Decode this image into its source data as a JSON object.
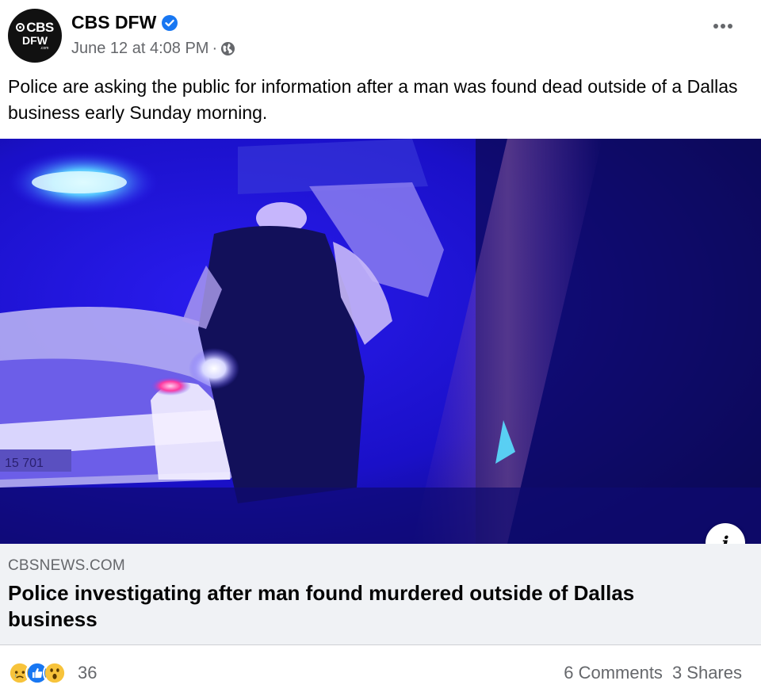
{
  "post": {
    "page_name": "CBS DFW",
    "avatar": {
      "line1": "CBS",
      "line2": "DFW",
      "line3": ".com"
    },
    "timestamp": "June 12 at 4:08 PM",
    "separator": "·",
    "audience_icon": "globe-icon",
    "verified_icon": "verified-badge-icon",
    "menu_icon": "more-options-icon",
    "caption": "Police are asking the public for information after a man was found dead outside of a Dallas business early Sunday morning."
  },
  "link_preview": {
    "image_description_icon": "police-scene-image",
    "info_icon": "info-icon",
    "info_label": "i",
    "domain": "CBSNEWS.COM",
    "title": "Police investigating after man found murdered outside of Dallas business",
    "plate_text": "15 701"
  },
  "engagement": {
    "reaction_icons": [
      "sad-reaction-icon",
      "like-reaction-icon",
      "wow-reaction-icon"
    ],
    "reaction_count": "36",
    "comments": "6 Comments",
    "shares": "3 Shares"
  },
  "colors": {
    "accent": "#1877f2",
    "secondary_text": "#65676b",
    "link_bg": "#f0f2f5",
    "image_blue": "#1a10c8"
  }
}
